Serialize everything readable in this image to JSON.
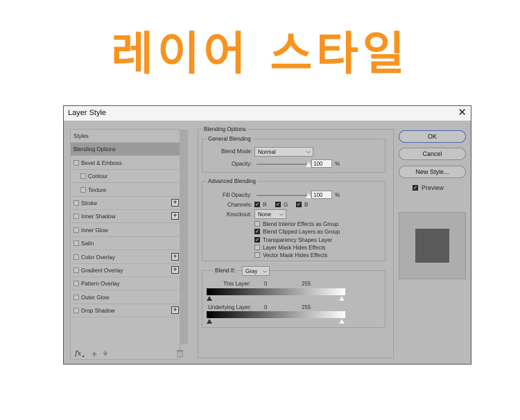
{
  "headline": "레이어 스타일",
  "dialog": {
    "title": "Layer Style",
    "close_glyph": "✕"
  },
  "style_list": {
    "items": [
      {
        "label": "Styles",
        "checkbox": false,
        "plus": false,
        "selected": false,
        "indent": 0
      },
      {
        "label": "Blending Options",
        "checkbox": false,
        "plus": false,
        "selected": true,
        "indent": 0
      },
      {
        "label": "Bevel & Emboss",
        "checkbox": true,
        "plus": false,
        "selected": false,
        "indent": 0
      },
      {
        "label": "Contour",
        "checkbox": true,
        "plus": false,
        "selected": false,
        "indent": 1
      },
      {
        "label": "Texture",
        "checkbox": true,
        "plus": false,
        "selected": false,
        "indent": 1
      },
      {
        "label": "Stroke",
        "checkbox": true,
        "plus": true,
        "selected": false,
        "indent": 0
      },
      {
        "label": "Inner Shadow",
        "checkbox": true,
        "plus": true,
        "selected": false,
        "indent": 0
      },
      {
        "label": "Inner Glow",
        "checkbox": true,
        "plus": false,
        "selected": false,
        "indent": 0
      },
      {
        "label": "Satin",
        "checkbox": true,
        "plus": false,
        "selected": false,
        "indent": 0
      },
      {
        "label": "Color Overlay",
        "checkbox": true,
        "plus": true,
        "selected": false,
        "indent": 0
      },
      {
        "label": "Gradient Overlay",
        "checkbox": true,
        "plus": true,
        "selected": false,
        "indent": 0
      },
      {
        "label": "Pattern Overlay",
        "checkbox": true,
        "plus": false,
        "selected": false,
        "indent": 0
      },
      {
        "label": "Outer Glow",
        "checkbox": true,
        "plus": false,
        "selected": false,
        "indent": 0
      },
      {
        "label": "Drop Shadow",
        "checkbox": true,
        "plus": true,
        "selected": false,
        "indent": 0
      }
    ],
    "plus_glyph": "+",
    "footer": {
      "fx_icon": "fx-icon",
      "up_icon": "arrow-up-icon",
      "down_icon": "arrow-down-icon",
      "trash_icon": "trash-icon"
    }
  },
  "blending": {
    "section_title": "Blending Options",
    "general": {
      "title": "General Blending",
      "blend_mode_label": "Blend Mode:",
      "blend_mode_value": "Normal",
      "opacity_label": "Opacity:",
      "opacity_value": "100",
      "opacity_fraction": 1.0,
      "percent": "%"
    },
    "advanced": {
      "title": "Advanced Blending",
      "fill_label": "Fill Opacity:",
      "fill_value": "100",
      "fill_fraction": 1.0,
      "percent": "%",
      "channels_label": "Channels:",
      "channels": [
        {
          "label": "R",
          "checked": true
        },
        {
          "label": "G",
          "checked": true
        },
        {
          "label": "B",
          "checked": true
        }
      ],
      "knockout_label": "Knockout:",
      "knockout_value": "None",
      "options": [
        {
          "label": "Blend Interior Effects as Group",
          "checked": false
        },
        {
          "label": "Blend Clipped Layers as Group",
          "checked": true
        },
        {
          "label": "Transparency Shapes Layer",
          "checked": true
        },
        {
          "label": "Layer Mask Hides Effects",
          "checked": false
        },
        {
          "label": "Vector Mask Hides Effects",
          "checked": false
        }
      ]
    },
    "blend_if": {
      "label": "Blend If:",
      "value": "Gray",
      "this_layer_label": "This Layer:",
      "this_low": "0",
      "this_high": "255",
      "under_label": "Underlying Layer:",
      "under_low": "0",
      "under_high": "255"
    }
  },
  "buttons": {
    "ok": "OK",
    "cancel": "Cancel",
    "new_style": "New Style..."
  },
  "preview": {
    "label": "Preview",
    "checked": true,
    "swatch_color": "#5a5a5a"
  },
  "colors": {
    "headline": "#f7931e",
    "ok_border": "#4a67b0"
  }
}
